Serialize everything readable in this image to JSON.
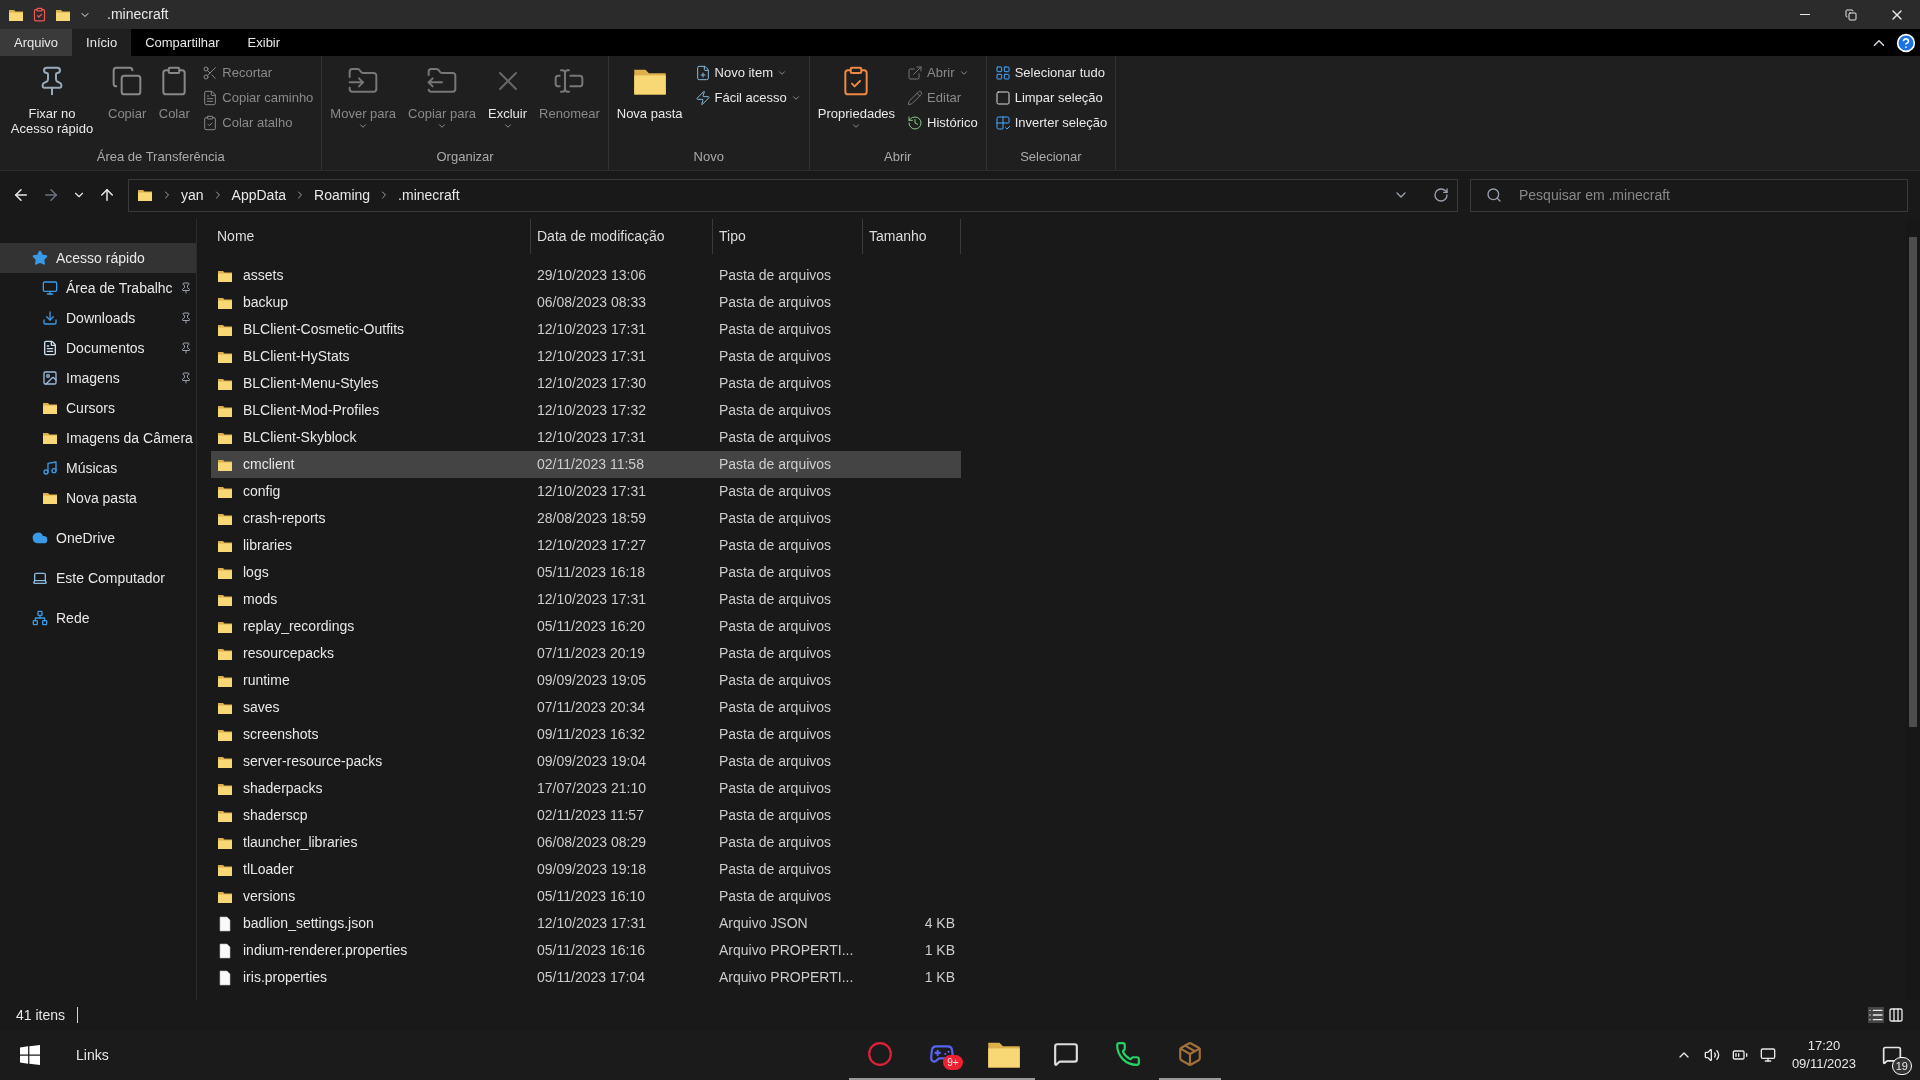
{
  "window": {
    "title": ".minecraft"
  },
  "ribbon_tabs": [
    {
      "label": "Arquivo",
      "selected": false,
      "kind": "file"
    },
    {
      "label": "Início",
      "selected": true,
      "kind": "tab"
    },
    {
      "label": "Compartilhar",
      "selected": false,
      "kind": "tab"
    },
    {
      "label": "Exibir",
      "selected": false,
      "kind": "tab"
    }
  ],
  "ribbon_groups": [
    {
      "label": "Área de Transferência",
      "items": [
        {
          "kind": "large",
          "label": "Fixar no Acesso rápido",
          "disabled": false
        },
        {
          "kind": "large",
          "label": "Copiar",
          "disabled": true
        },
        {
          "kind": "large",
          "label": "Colar",
          "disabled": true
        },
        {
          "kind": "stack",
          "items": [
            {
              "label": "Recortar",
              "disabled": true
            },
            {
              "label": "Copiar caminho",
              "disabled": true
            },
            {
              "label": "Colar atalho",
              "disabled": true
            }
          ]
        }
      ]
    },
    {
      "label": "Organizar",
      "items": [
        {
          "kind": "large",
          "label": "Mover para",
          "disabled": true,
          "caret": true
        },
        {
          "kind": "large",
          "label": "Copiar para",
          "disabled": true,
          "caret": true
        },
        {
          "kind": "large",
          "label": "Excluir",
          "disabled": false,
          "caret": true
        },
        {
          "kind": "large",
          "label": "Renomear",
          "disabled": true
        }
      ]
    },
    {
      "label": "Novo",
      "items": [
        {
          "kind": "large",
          "label": "Nova pasta",
          "disabled": false
        },
        {
          "kind": "stack",
          "items": [
            {
              "label": "Novo item",
              "disabled": false,
              "caret": true
            },
            {
              "label": "Fácil acesso",
              "disabled": false,
              "caret": true
            }
          ]
        }
      ]
    },
    {
      "label": "Abrir",
      "items": [
        {
          "kind": "large",
          "label": "Propriedades",
          "disabled": false,
          "caret": true
        },
        {
          "kind": "stack",
          "items": [
            {
              "label": "Abrir",
              "disabled": true,
              "caret": true
            },
            {
              "label": "Editar",
              "disabled": true
            },
            {
              "label": "Histórico",
              "disabled": false
            }
          ]
        }
      ]
    },
    {
      "label": "Selecionar",
      "items": [
        {
          "kind": "stack",
          "items": [
            {
              "label": "Selecionar tudo",
              "disabled": false
            },
            {
              "label": "Limpar seleção",
              "disabled": false
            },
            {
              "label": "Inverter seleção",
              "disabled": false
            }
          ]
        }
      ]
    }
  ],
  "address_bar": {
    "path": [
      "yan",
      "AppData",
      "Roaming",
      ".minecraft"
    ]
  },
  "search": {
    "placeholder": "Pesquisar em .minecraft"
  },
  "sidebar": {
    "items": [
      {
        "label": "Acesso rápido",
        "selected": true,
        "children": [
          {
            "label": "Área de Trabalhc",
            "pinned": true,
            "selected": false
          },
          {
            "label": "Downloads",
            "pinned": true,
            "selected": false
          },
          {
            "label": "Documentos",
            "pinned": true,
            "selected": false
          },
          {
            "label": "Imagens",
            "pinned": true,
            "selected": false
          },
          {
            "label": "Cursors",
            "pinned": false,
            "selected": false
          },
          {
            "label": "Imagens da Câmera",
            "pinned": false,
            "selected": false
          },
          {
            "label": "Músicas",
            "pinned": false,
            "selected": false
          },
          {
            "label": "Nova pasta",
            "pinned": false,
            "selected": false
          }
        ]
      },
      {
        "label": "OneDrive",
        "selected": false
      },
      {
        "label": "Este Computador",
        "selected": false
      },
      {
        "label": "Rede",
        "selected": false
      }
    ]
  },
  "table": {
    "columns": [
      "Nome",
      "Data de modificação",
      "Tipo",
      "Tamanho"
    ],
    "rows": [
      {
        "kind": "folder",
        "name": "assets",
        "date": "29/10/2023 13:06",
        "type": "Pasta de arquivos",
        "selected": false
      },
      {
        "kind": "folder",
        "name": "backup",
        "date": "06/08/2023 08:33",
        "type": "Pasta de arquivos",
        "selected": false
      },
      {
        "kind": "folder",
        "name": "BLClient-Cosmetic-Outfits",
        "date": "12/10/2023 17:31",
        "type": "Pasta de arquivos",
        "selected": false
      },
      {
        "kind": "folder",
        "name": "BLClient-HyStats",
        "date": "12/10/2023 17:31",
        "type": "Pasta de arquivos",
        "selected": false
      },
      {
        "kind": "folder",
        "name": "BLClient-Menu-Styles",
        "date": "12/10/2023 17:30",
        "type": "Pasta de arquivos",
        "selected": false
      },
      {
        "kind": "folder",
        "name": "BLClient-Mod-Profiles",
        "date": "12/10/2023 17:32",
        "type": "Pasta de arquivos",
        "selected": false
      },
      {
        "kind": "folder",
        "name": "BLClient-Skyblock",
        "date": "12/10/2023 17:31",
        "type": "Pasta de arquivos",
        "selected": false
      },
      {
        "kind": "folder",
        "name": "cmclient",
        "date": "02/11/2023 11:58",
        "type": "Pasta de arquivos",
        "selected": true
      },
      {
        "kind": "folder",
        "name": "config",
        "date": "12/10/2023 17:31",
        "type": "Pasta de arquivos",
        "selected": false
      },
      {
        "kind": "folder",
        "name": "crash-reports",
        "date": "28/08/2023 18:59",
        "type": "Pasta de arquivos",
        "selected": false
      },
      {
        "kind": "folder",
        "name": "libraries",
        "date": "12/10/2023 17:27",
        "type": "Pasta de arquivos",
        "selected": false
      },
      {
        "kind": "folder",
        "name": "logs",
        "date": "05/11/2023 16:18",
        "type": "Pasta de arquivos",
        "selected": false
      },
      {
        "kind": "folder",
        "name": "mods",
        "date": "12/10/2023 17:31",
        "type": "Pasta de arquivos",
        "selected": false
      },
      {
        "kind": "folder",
        "name": "replay_recordings",
        "date": "05/11/2023 16:20",
        "type": "Pasta de arquivos",
        "selected": false
      },
      {
        "kind": "folder",
        "name": "resourcepacks",
        "date": "07/11/2023 20:19",
        "type": "Pasta de arquivos",
        "selected": false
      },
      {
        "kind": "folder",
        "name": "runtime",
        "date": "09/09/2023 19:05",
        "type": "Pasta de arquivos",
        "selected": false
      },
      {
        "kind": "folder",
        "name": "saves",
        "date": "07/11/2023 20:34",
        "type": "Pasta de arquivos",
        "selected": false
      },
      {
        "kind": "folder",
        "name": "screenshots",
        "date": "09/11/2023 16:32",
        "type": "Pasta de arquivos",
        "selected": false
      },
      {
        "kind": "folder",
        "name": "server-resource-packs",
        "date": "09/09/2023 19:04",
        "type": "Pasta de arquivos",
        "selected": false
      },
      {
        "kind": "folder",
        "name": "shaderpacks",
        "date": "17/07/2023 21:10",
        "type": "Pasta de arquivos",
        "selected": false
      },
      {
        "kind": "folder",
        "name": "shaderscp",
        "date": "02/11/2023 11:57",
        "type": "Pasta de arquivos",
        "selected": false
      },
      {
        "kind": "folder",
        "name": "tlauncher_libraries",
        "date": "06/08/2023 08:29",
        "type": "Pasta de arquivos",
        "selected": false
      },
      {
        "kind": "folder",
        "name": "tlLoader",
        "date": "09/09/2023 19:18",
        "type": "Pasta de arquivos",
        "selected": false
      },
      {
        "kind": "folder",
        "name": "versions",
        "date": "05/11/2023 16:10",
        "type": "Pasta de arquivos",
        "selected": false
      },
      {
        "kind": "file",
        "name": "badlion_settings.json",
        "date": "12/10/2023 17:31",
        "type": "Arquivo JSON",
        "size": "4 KB",
        "selected": false
      },
      {
        "kind": "file",
        "name": "indium-renderer.properties",
        "date": "05/11/2023 16:16",
        "type": "Arquivo PROPERTI...",
        "size": "1 KB",
        "selected": false
      },
      {
        "kind": "file",
        "name": "iris.properties",
        "date": "05/11/2023 17:04",
        "type": "Arquivo PROPERTI...",
        "size": "1 KB",
        "selected": false
      }
    ]
  },
  "status_bar": {
    "item_count": "41 itens"
  },
  "taskbar": {
    "toolbar_label": "Links",
    "apps": [
      {
        "running": true
      },
      {
        "running": true,
        "badge": "9+"
      },
      {
        "running": true
      },
      {
        "running": false
      },
      {
        "running": false
      },
      {
        "running": true
      }
    ],
    "time": "17:20",
    "date": "09/11/2023",
    "notifications": "19"
  }
}
